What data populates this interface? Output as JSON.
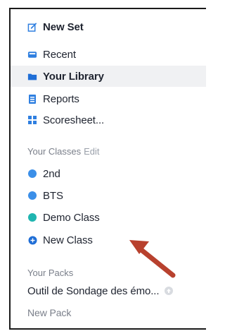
{
  "menu": {
    "new_set": {
      "label": "New Set",
      "icon": "edit-icon"
    },
    "recent": {
      "label": "Recent",
      "icon": "history-icon"
    },
    "library": {
      "label": "Your Library",
      "icon": "folder-icon"
    },
    "reports": {
      "label": "Reports",
      "icon": "document-icon"
    },
    "scoresheet": {
      "label": "Scoresheet...",
      "icon": "grid-icon"
    }
  },
  "classes": {
    "heading": "Your Classes",
    "edit_label": "Edit",
    "items": [
      {
        "label": "2nd",
        "color": "#3b8fe8"
      },
      {
        "label": "BTS",
        "color": "#3b8fe8"
      },
      {
        "label": "Demo Class",
        "color": "#1fb5b0"
      }
    ],
    "new_class": {
      "label": "New Class",
      "icon": "plus-circle-icon"
    }
  },
  "packs": {
    "heading": "Your Packs",
    "items": [
      {
        "label": "Outil de Sondage des émo..."
      }
    ],
    "new_pack": "New Pack"
  },
  "colors": {
    "accent": "#3b8fe8",
    "arrow": "#b8412e"
  }
}
